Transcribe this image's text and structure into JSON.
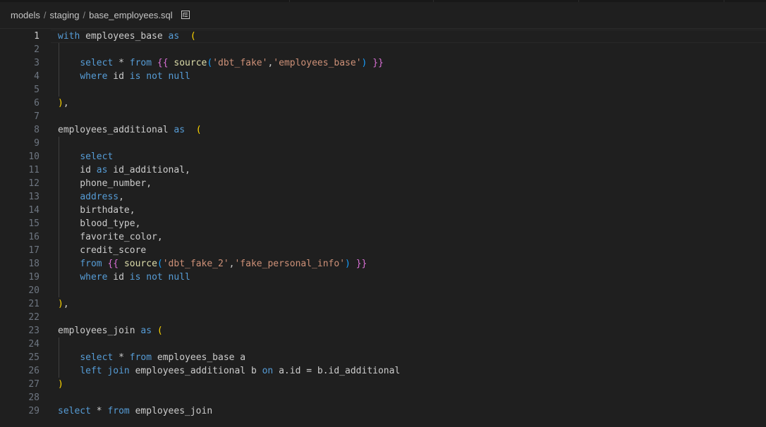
{
  "breadcrumbs": [
    "models",
    "staging",
    "base_employees.sql"
  ],
  "breadcrumb_separator": "/",
  "outline_icon": "list-outline-icon",
  "active_line": 1,
  "colors": {
    "keyword": "#569cd6",
    "bracket_level1": "#ffd700",
    "bracket_level2": "#da70d6",
    "bracket_level3": "#179fff",
    "string": "#ce9178",
    "function": "#dcdcaa",
    "line_number": "#6e7681",
    "background": "#1f1f1f"
  },
  "lines": [
    {
      "n": "1",
      "tokens": [
        [
          "kw",
          "with"
        ],
        [
          "pl",
          " employees_base "
        ],
        [
          "kw",
          "as"
        ],
        [
          "pl",
          "  "
        ],
        [
          "br1",
          "("
        ]
      ]
    },
    {
      "n": "2",
      "tokens": []
    },
    {
      "n": "3",
      "tokens": [
        [
          "pl",
          "    "
        ],
        [
          "kw",
          "select"
        ],
        [
          "pl",
          " * "
        ],
        [
          "kw",
          "from"
        ],
        [
          "pl",
          " "
        ],
        [
          "br2",
          "{{"
        ],
        [
          "pl",
          " "
        ],
        [
          "fn",
          "source"
        ],
        [
          "br3",
          "("
        ],
        [
          "str",
          "'dbt_fake'"
        ],
        [
          "pl",
          ","
        ],
        [
          "str",
          "'employees_base'"
        ],
        [
          "br3",
          ")"
        ],
        [
          "pl",
          " "
        ],
        [
          "br2",
          "}}"
        ]
      ]
    },
    {
      "n": "4",
      "tokens": [
        [
          "pl",
          "    "
        ],
        [
          "kw",
          "where"
        ],
        [
          "pl",
          " id "
        ],
        [
          "kw",
          "is not null"
        ]
      ]
    },
    {
      "n": "5",
      "tokens": []
    },
    {
      "n": "6",
      "tokens": [
        [
          "br1",
          ")"
        ],
        [
          "pl",
          ","
        ]
      ]
    },
    {
      "n": "7",
      "tokens": []
    },
    {
      "n": "8",
      "tokens": [
        [
          "pl",
          "employees_additional "
        ],
        [
          "kw",
          "as"
        ],
        [
          "pl",
          "  "
        ],
        [
          "br1",
          "("
        ]
      ]
    },
    {
      "n": "9",
      "tokens": []
    },
    {
      "n": "10",
      "tokens": [
        [
          "pl",
          "    "
        ],
        [
          "kw",
          "select"
        ]
      ]
    },
    {
      "n": "11",
      "tokens": [
        [
          "pl",
          "    id "
        ],
        [
          "kw",
          "as"
        ],
        [
          "pl",
          " id_additional,"
        ]
      ]
    },
    {
      "n": "12",
      "tokens": [
        [
          "pl",
          "    phone_number,"
        ]
      ]
    },
    {
      "n": "13",
      "tokens": [
        [
          "pl",
          "    "
        ],
        [
          "kw",
          "address"
        ],
        [
          "pl",
          ","
        ]
      ]
    },
    {
      "n": "14",
      "tokens": [
        [
          "pl",
          "    birthdate,"
        ]
      ]
    },
    {
      "n": "15",
      "tokens": [
        [
          "pl",
          "    blood_type,"
        ]
      ]
    },
    {
      "n": "16",
      "tokens": [
        [
          "pl",
          "    favorite_color,"
        ]
      ]
    },
    {
      "n": "17",
      "tokens": [
        [
          "pl",
          "    credit_score"
        ]
      ]
    },
    {
      "n": "18",
      "tokens": [
        [
          "pl",
          "    "
        ],
        [
          "kw",
          "from"
        ],
        [
          "pl",
          " "
        ],
        [
          "br2",
          "{{"
        ],
        [
          "pl",
          " "
        ],
        [
          "fn",
          "source"
        ],
        [
          "br3",
          "("
        ],
        [
          "str",
          "'dbt_fake_2'"
        ],
        [
          "pl",
          ","
        ],
        [
          "str",
          "'fake_personal_info'"
        ],
        [
          "br3",
          ")"
        ],
        [
          "pl",
          " "
        ],
        [
          "br2",
          "}}"
        ]
      ]
    },
    {
      "n": "19",
      "tokens": [
        [
          "pl",
          "    "
        ],
        [
          "kw",
          "where"
        ],
        [
          "pl",
          " id "
        ],
        [
          "kw",
          "is not null"
        ]
      ]
    },
    {
      "n": "20",
      "tokens": []
    },
    {
      "n": "21",
      "tokens": [
        [
          "br1",
          ")"
        ],
        [
          "pl",
          ","
        ]
      ]
    },
    {
      "n": "22",
      "tokens": []
    },
    {
      "n": "23",
      "tokens": [
        [
          "pl",
          "employees_join "
        ],
        [
          "kw",
          "as"
        ],
        [
          "pl",
          " "
        ],
        [
          "br1",
          "("
        ]
      ]
    },
    {
      "n": "24",
      "tokens": []
    },
    {
      "n": "25",
      "tokens": [
        [
          "pl",
          "    "
        ],
        [
          "kw",
          "select"
        ],
        [
          "pl",
          " * "
        ],
        [
          "kw",
          "from"
        ],
        [
          "pl",
          " employees_base a"
        ]
      ]
    },
    {
      "n": "26",
      "tokens": [
        [
          "pl",
          "    "
        ],
        [
          "kw",
          "left join"
        ],
        [
          "pl",
          " employees_additional b "
        ],
        [
          "kw",
          "on"
        ],
        [
          "pl",
          " a.id = b.id_additional"
        ]
      ]
    },
    {
      "n": "27",
      "tokens": [
        [
          "br1",
          ")"
        ]
      ]
    },
    {
      "n": "28",
      "tokens": []
    },
    {
      "n": "29",
      "tokens": [
        [
          "kw",
          "select"
        ],
        [
          "pl",
          " * "
        ],
        [
          "kw",
          "from"
        ],
        [
          "pl",
          " employees_join"
        ]
      ]
    }
  ]
}
